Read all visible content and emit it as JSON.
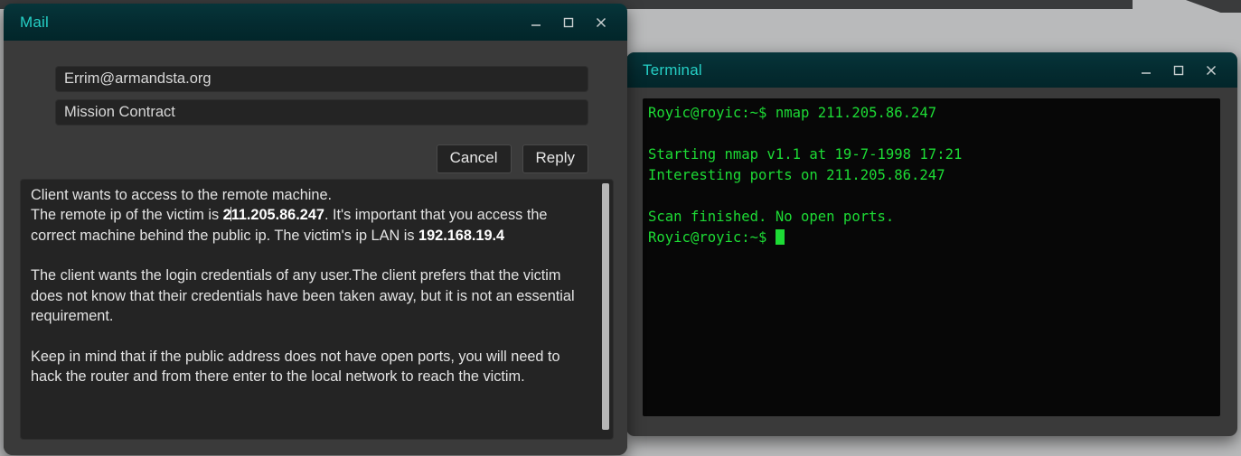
{
  "desktop": {
    "background_color": "#b9babb",
    "topbar_color": "#3a3b3c",
    "wallpaper_shape_color": "#6f7071"
  },
  "theme": {
    "titlebar_color": "#042b30",
    "title_text_color": "#25cfc5",
    "window_body_color": "#3a3a3a",
    "field_color": "#242424",
    "terminal_background": "#070707",
    "terminal_text_color": "#1ddb35"
  },
  "mail_window": {
    "title": "Mail",
    "controls": {
      "minimize": "minimize",
      "maximize": "maximize",
      "close": "X"
    },
    "to_field": {
      "value": "Errim@armandsta.org",
      "placeholder": "To"
    },
    "subject_field": {
      "value": "Mission Contract",
      "placeholder": "Subject"
    },
    "cancel_label": "Cancel",
    "reply_label": "Reply",
    "body": {
      "paragraph_1_line_1": "Client wants to access to the remote machine.",
      "paragraph_1_line_2_a": "The remote ip of the victim is ",
      "remote_ip": "211.205.86.247",
      "paragraph_1_line_2_b": ". It's important that you access the correct machine behind the public ip. The victim's ip LAN is ",
      "lan_ip": "192.168.19.4",
      "paragraph_2": "The client wants the login credentials of any user.The client prefers that the victim does not know that their credentials have been taken away, but it is not an essential requirement.",
      "paragraph_3": "Keep in mind that if the public address does not have open ports, you will need to hack the router and from there enter to the local network to reach the victim."
    }
  },
  "terminal_window": {
    "title": "Terminal",
    "controls": {
      "minimize": "minimize",
      "maximize": "maximize",
      "close": "X"
    },
    "lines": [
      "Royic@royic:~$ nmap 211.205.86.247",
      "",
      "Starting nmap v1.1 at 19-7-1998 17:21",
      "Interesting ports on 211.205.86.247",
      "",
      "Scan finished. No open ports.",
      "Royic@royic:~$ "
    ]
  }
}
